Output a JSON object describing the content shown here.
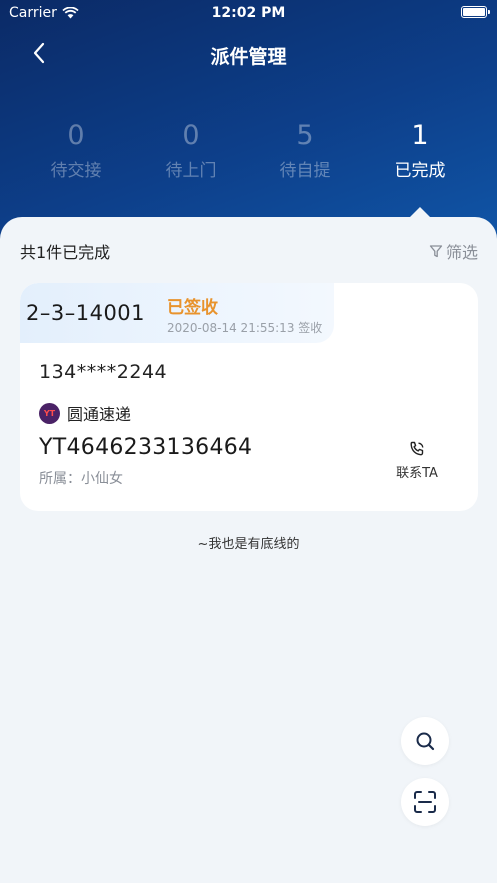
{
  "status_bar": {
    "carrier": "Carrier",
    "time": "12:02 PM"
  },
  "nav": {
    "title": "派件管理"
  },
  "stats": [
    {
      "count": "0",
      "label": "待交接"
    },
    {
      "count": "0",
      "label": "待上门"
    },
    {
      "count": "5",
      "label": "待自提"
    },
    {
      "count": "1",
      "label": "已完成"
    }
  ],
  "active_tab": "已完成",
  "summary": {
    "text": "共1件已完成",
    "filter_label": "筛选"
  },
  "parcel": {
    "room": "2–3–14001",
    "status": "已签收",
    "sign_time": "2020-08-14 21:55:13 签收",
    "phone": "134****2244",
    "courier": "圆通速递",
    "courier_logo": "YT",
    "tracking_no": "YT4646233136464",
    "owner": "所属：小仙女",
    "contact_label": "联系TA"
  },
  "bottom_note": "~我也是有底线的",
  "colors": {
    "accent_orange": "#e8932d",
    "header_blue": "#0d3f8a"
  }
}
